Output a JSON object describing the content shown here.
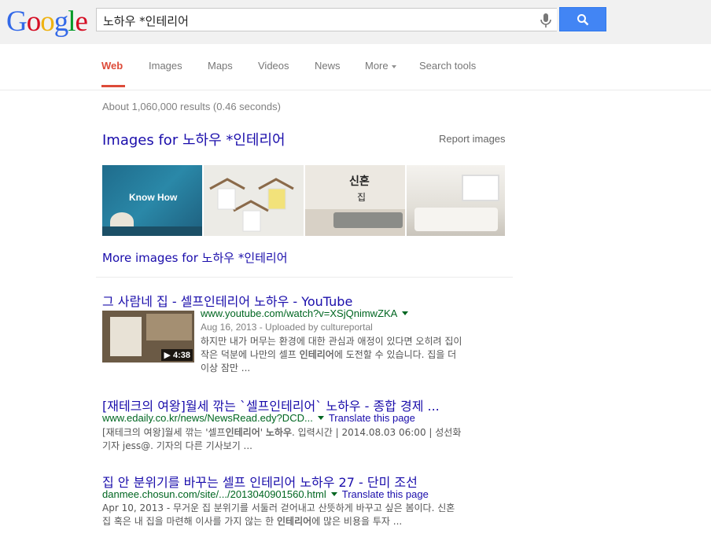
{
  "header": {
    "logo_text": "Google",
    "query": "노하우 *인테리어"
  },
  "tabs": [
    {
      "label": "Web",
      "active": true
    },
    {
      "label": "Images"
    },
    {
      "label": "Maps"
    },
    {
      "label": "Videos"
    },
    {
      "label": "News"
    },
    {
      "label": "More"
    },
    {
      "label": "Search tools"
    }
  ],
  "stats": "About 1,060,000 results (0.46 seconds)",
  "images_block": {
    "title": "Images for 노하우 *인테리어",
    "report": "Report images",
    "thumb1_text": "Know How",
    "thumb3_text": "신혼",
    "thumb3_text2": "집",
    "more_link": "More images for 노하우 *인테리어"
  },
  "results": [
    {
      "title": "그 사람네 집 - 셀프인테리어 노하우 - YouTube",
      "url": "www.youtube.com/watch?v=XSjQnimwZKA",
      "meta": "Aug 16, 2013 - Uploaded by cultureportal",
      "snippet_1": "하지만 내가 머무는 환경에 대한 관심과 애정이 있다면 오히려 집이",
      "snippet_2a": "작은 덕분에 나만의 셀프 ",
      "snippet_2b": "인테리어",
      "snippet_2c": "에 도전할 수 있습니다. 집을 더",
      "snippet_3": "이상 잠만 ...",
      "duration": "4:38"
    },
    {
      "title": "[재테크의 여왕]월세 깎는 `셀프인테리어` 노하우 - 종합 경제 ...",
      "url": "www.edaily.co.kr/news/NewsRead.edy?DCD...",
      "translate": "Translate this page",
      "snippet_1a": "[재테크의 여왕]월세 깎는 '셀프",
      "snippet_1b": "인테리어",
      "snippet_1c": "' ",
      "snippet_1d": "노하우",
      "snippet_1e": ". 입력시간 | 2014.08.03 06:00 | 성선화",
      "snippet_2": "기자 jess@. 기자의 다른 기사보기 ..."
    },
    {
      "title": "집 안 분위기를 바꾸는 셀프 인테리어 노하우 27 - 단미 조선",
      "url": "danmee.chosun.com/site/.../2013040901560.html",
      "translate": "Translate this page",
      "snippet_1": "Apr 10, 2013 - 무거운 집 분위기를 서둘러 걷어내고 산뜻하게 바꾸고 싶은 봄이다. 신혼",
      "snippet_2a": "집 혹은 내 집을 마련해 이사를 가지 않는 한 ",
      "snippet_2b": "인테리어",
      "snippet_2c": "에 많은 비용을 투자 ..."
    }
  ],
  "colors": {
    "link": "#1a0dab",
    "url": "#006621",
    "accent": "#dd4b39",
    "button": "#4285f4"
  }
}
